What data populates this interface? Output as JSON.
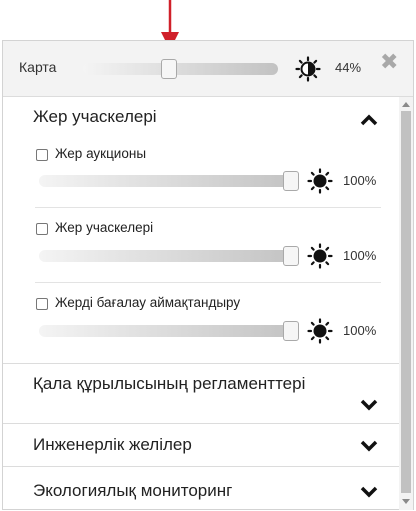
{
  "header": {
    "map_label": "Карта",
    "opacity": "44%",
    "opacity_value": 0.44
  },
  "sections": [
    {
      "title": "Жер учаскелері",
      "expanded": true,
      "items": [
        {
          "label": "Жер аукционы",
          "checked": false,
          "opacity": "100%"
        },
        {
          "label": "Жер учаскелері",
          "checked": false,
          "opacity": "100%"
        },
        {
          "label": "Жерді бағалау аймақтандыру",
          "checked": false,
          "opacity": "100%"
        }
      ]
    },
    {
      "title": "Қала құрылысының регламенттері",
      "expanded": false
    },
    {
      "title": "Инженерлік желілер",
      "expanded": false
    },
    {
      "title": "Экологиялық мониторинг",
      "expanded": false
    }
  ],
  "colors": {
    "annotation_arrow": "#d0202a",
    "header_bg": "#f3f3f3",
    "icon": "#111111"
  },
  "icons": {
    "brightness": "sun-icon",
    "close": "close-icon",
    "expand": "chevron-down-icon",
    "collapse": "chevron-up-icon"
  }
}
